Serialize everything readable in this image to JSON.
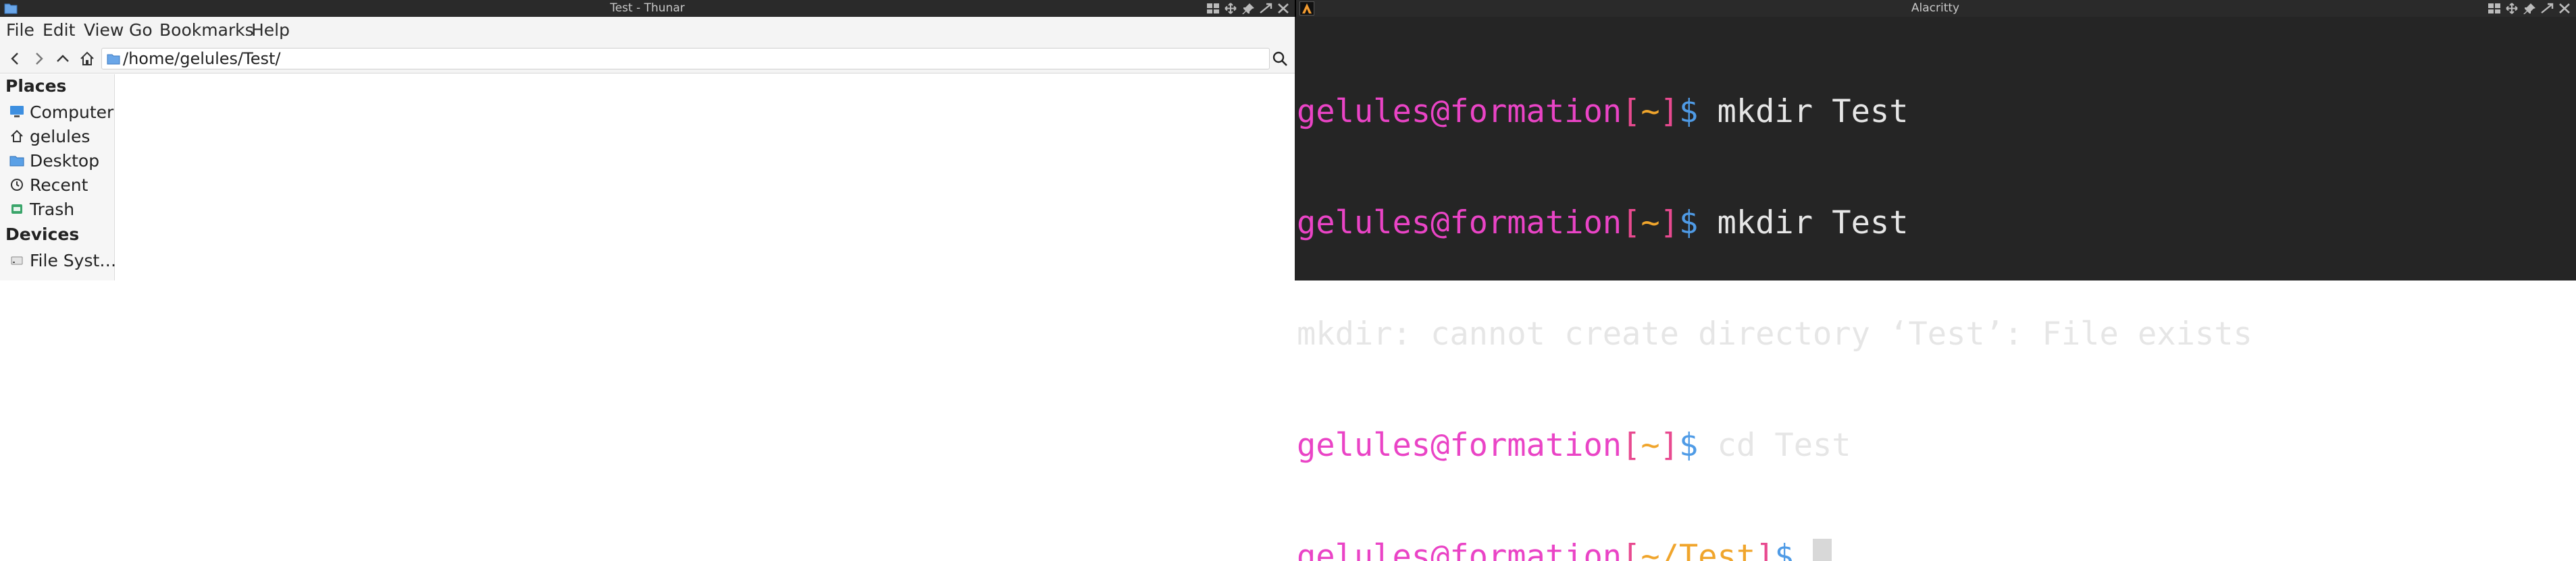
{
  "thunar": {
    "title": "Test - Thunar",
    "menu": [
      "File",
      "Edit",
      "View",
      "Go",
      "Bookmarks",
      "Help"
    ],
    "location": "/home/gelules/Test/",
    "sidebar": {
      "places_heading": "Places",
      "places": [
        {
          "label": "Computer",
          "icon": "computer-icon"
        },
        {
          "label": "gelules",
          "icon": "home-icon"
        },
        {
          "label": "Desktop",
          "icon": "desktop-folder-icon"
        },
        {
          "label": "Recent",
          "icon": "clock-icon"
        },
        {
          "label": "Trash",
          "icon": "trash-icon"
        }
      ],
      "devices_heading": "Devices",
      "devices": [
        {
          "label": "File Syst…",
          "icon": "drive-icon"
        }
      ]
    }
  },
  "alacritty": {
    "title": "Alacritty",
    "lines": [
      {
        "user": "gelules",
        "at": "@",
        "host": "formation",
        "open": "[",
        "path": "~",
        "close": "]",
        "dollar": "$",
        "cmd": " mkdir Test"
      },
      {
        "user": "gelules",
        "at": "@",
        "host": "formation",
        "open": "[",
        "path": "~",
        "close": "]",
        "dollar": "$",
        "cmd": " mkdir Test"
      },
      {
        "output": "mkdir: cannot create directory ‘Test’: File exists"
      },
      {
        "user": "gelules",
        "at": "@",
        "host": "formation",
        "open": "[",
        "path": "~",
        "close": "]",
        "dollar": "$",
        "cmd": " cd Test"
      },
      {
        "user": "gelules",
        "at": "@",
        "host": "formation",
        "open": "[",
        "path": "~/Test",
        "close": "]",
        "dollar": "$",
        "cmd": " "
      }
    ]
  },
  "colors": {
    "prompt_user": "#ea44c6",
    "prompt_bracket": "#e84a90",
    "prompt_path": "#f0a52c",
    "prompt_dollar": "#4f9be6",
    "terminal_bg": "#252525"
  }
}
